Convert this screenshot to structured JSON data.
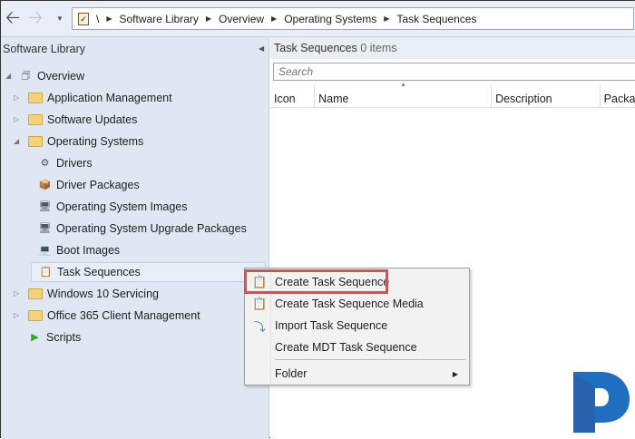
{
  "nav": {
    "back": "back",
    "forward": "forward",
    "breadcrumb": [
      "\\",
      "Software Library",
      "Overview",
      "Operating Systems",
      "Task Sequences"
    ]
  },
  "left": {
    "title": "Software Library",
    "tree": [
      {
        "label": "Overview",
        "level": 0,
        "expander": "open",
        "icon": "overview-icon"
      },
      {
        "label": "Application Management",
        "level": 1,
        "expander": "closed",
        "icon": "folder-icon"
      },
      {
        "label": "Software Updates",
        "level": 1,
        "expander": "closed",
        "icon": "folder-icon"
      },
      {
        "label": "Operating Systems",
        "level": 1,
        "expander": "open",
        "icon": "folder-icon"
      },
      {
        "label": "Drivers",
        "level": 2,
        "icon": "driver-icon"
      },
      {
        "label": "Driver Packages",
        "level": 2,
        "icon": "package-icon"
      },
      {
        "label": "Operating System Images",
        "level": 2,
        "icon": "os-image-icon"
      },
      {
        "label": "Operating System Upgrade Packages",
        "level": 2,
        "icon": "os-upgrade-icon"
      },
      {
        "label": "Boot Images",
        "level": 2,
        "icon": "boot-image-icon"
      },
      {
        "label": "Task Sequences",
        "level": 2,
        "icon": "task-sequence-icon",
        "selected": true
      },
      {
        "label": "Windows 10 Servicing",
        "level": 1,
        "expander": "closed",
        "icon": "folder-icon"
      },
      {
        "label": "Office 365 Client Management",
        "level": 1,
        "expander": "closed",
        "icon": "folder-icon"
      },
      {
        "label": "Scripts",
        "level": 1,
        "icon": "scripts-icon"
      }
    ]
  },
  "right": {
    "title": "Task Sequences",
    "count": "0 items",
    "search_placeholder": "Search",
    "columns": [
      "Icon",
      "Name",
      "Description",
      "Package"
    ]
  },
  "menu": {
    "items": [
      "Create Task Sequence",
      "Create Task Sequence Media",
      "Import Task Sequence",
      "Create MDT Task Sequence"
    ],
    "folder": "Folder"
  },
  "colors": {
    "highlight": "#e8484a",
    "logo": "#1f6fc0"
  }
}
